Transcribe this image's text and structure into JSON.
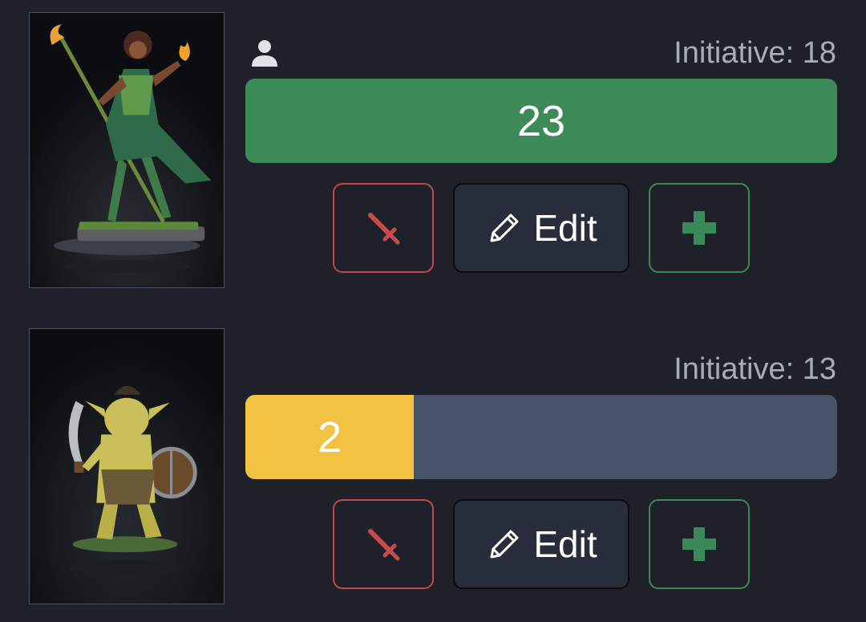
{
  "combatants": [
    {
      "initiative_text": "Initiative: 18",
      "hp_text": "23",
      "hp_fraction": 1.0,
      "hp_color": "#3e8a58",
      "is_player": true,
      "portrait": "sorceress-miniature",
      "edit_label": "Edit"
    },
    {
      "initiative_text": "Initiative: 13",
      "hp_text": "2",
      "hp_fraction": 0.285,
      "hp_color": "#f2c342",
      "is_player": false,
      "portrait": "goblin-miniature",
      "edit_label": "Edit"
    }
  ],
  "icons": {
    "player": "user-icon",
    "damage": "sword-icon",
    "edit": "pencil-icon",
    "heal": "plus-icon"
  },
  "colors": {
    "background": "#1e2129",
    "bar_empty": "#485269",
    "damage": "#c24a4a",
    "heal": "#3a8a59",
    "initiative_text": "#a4adb8"
  }
}
